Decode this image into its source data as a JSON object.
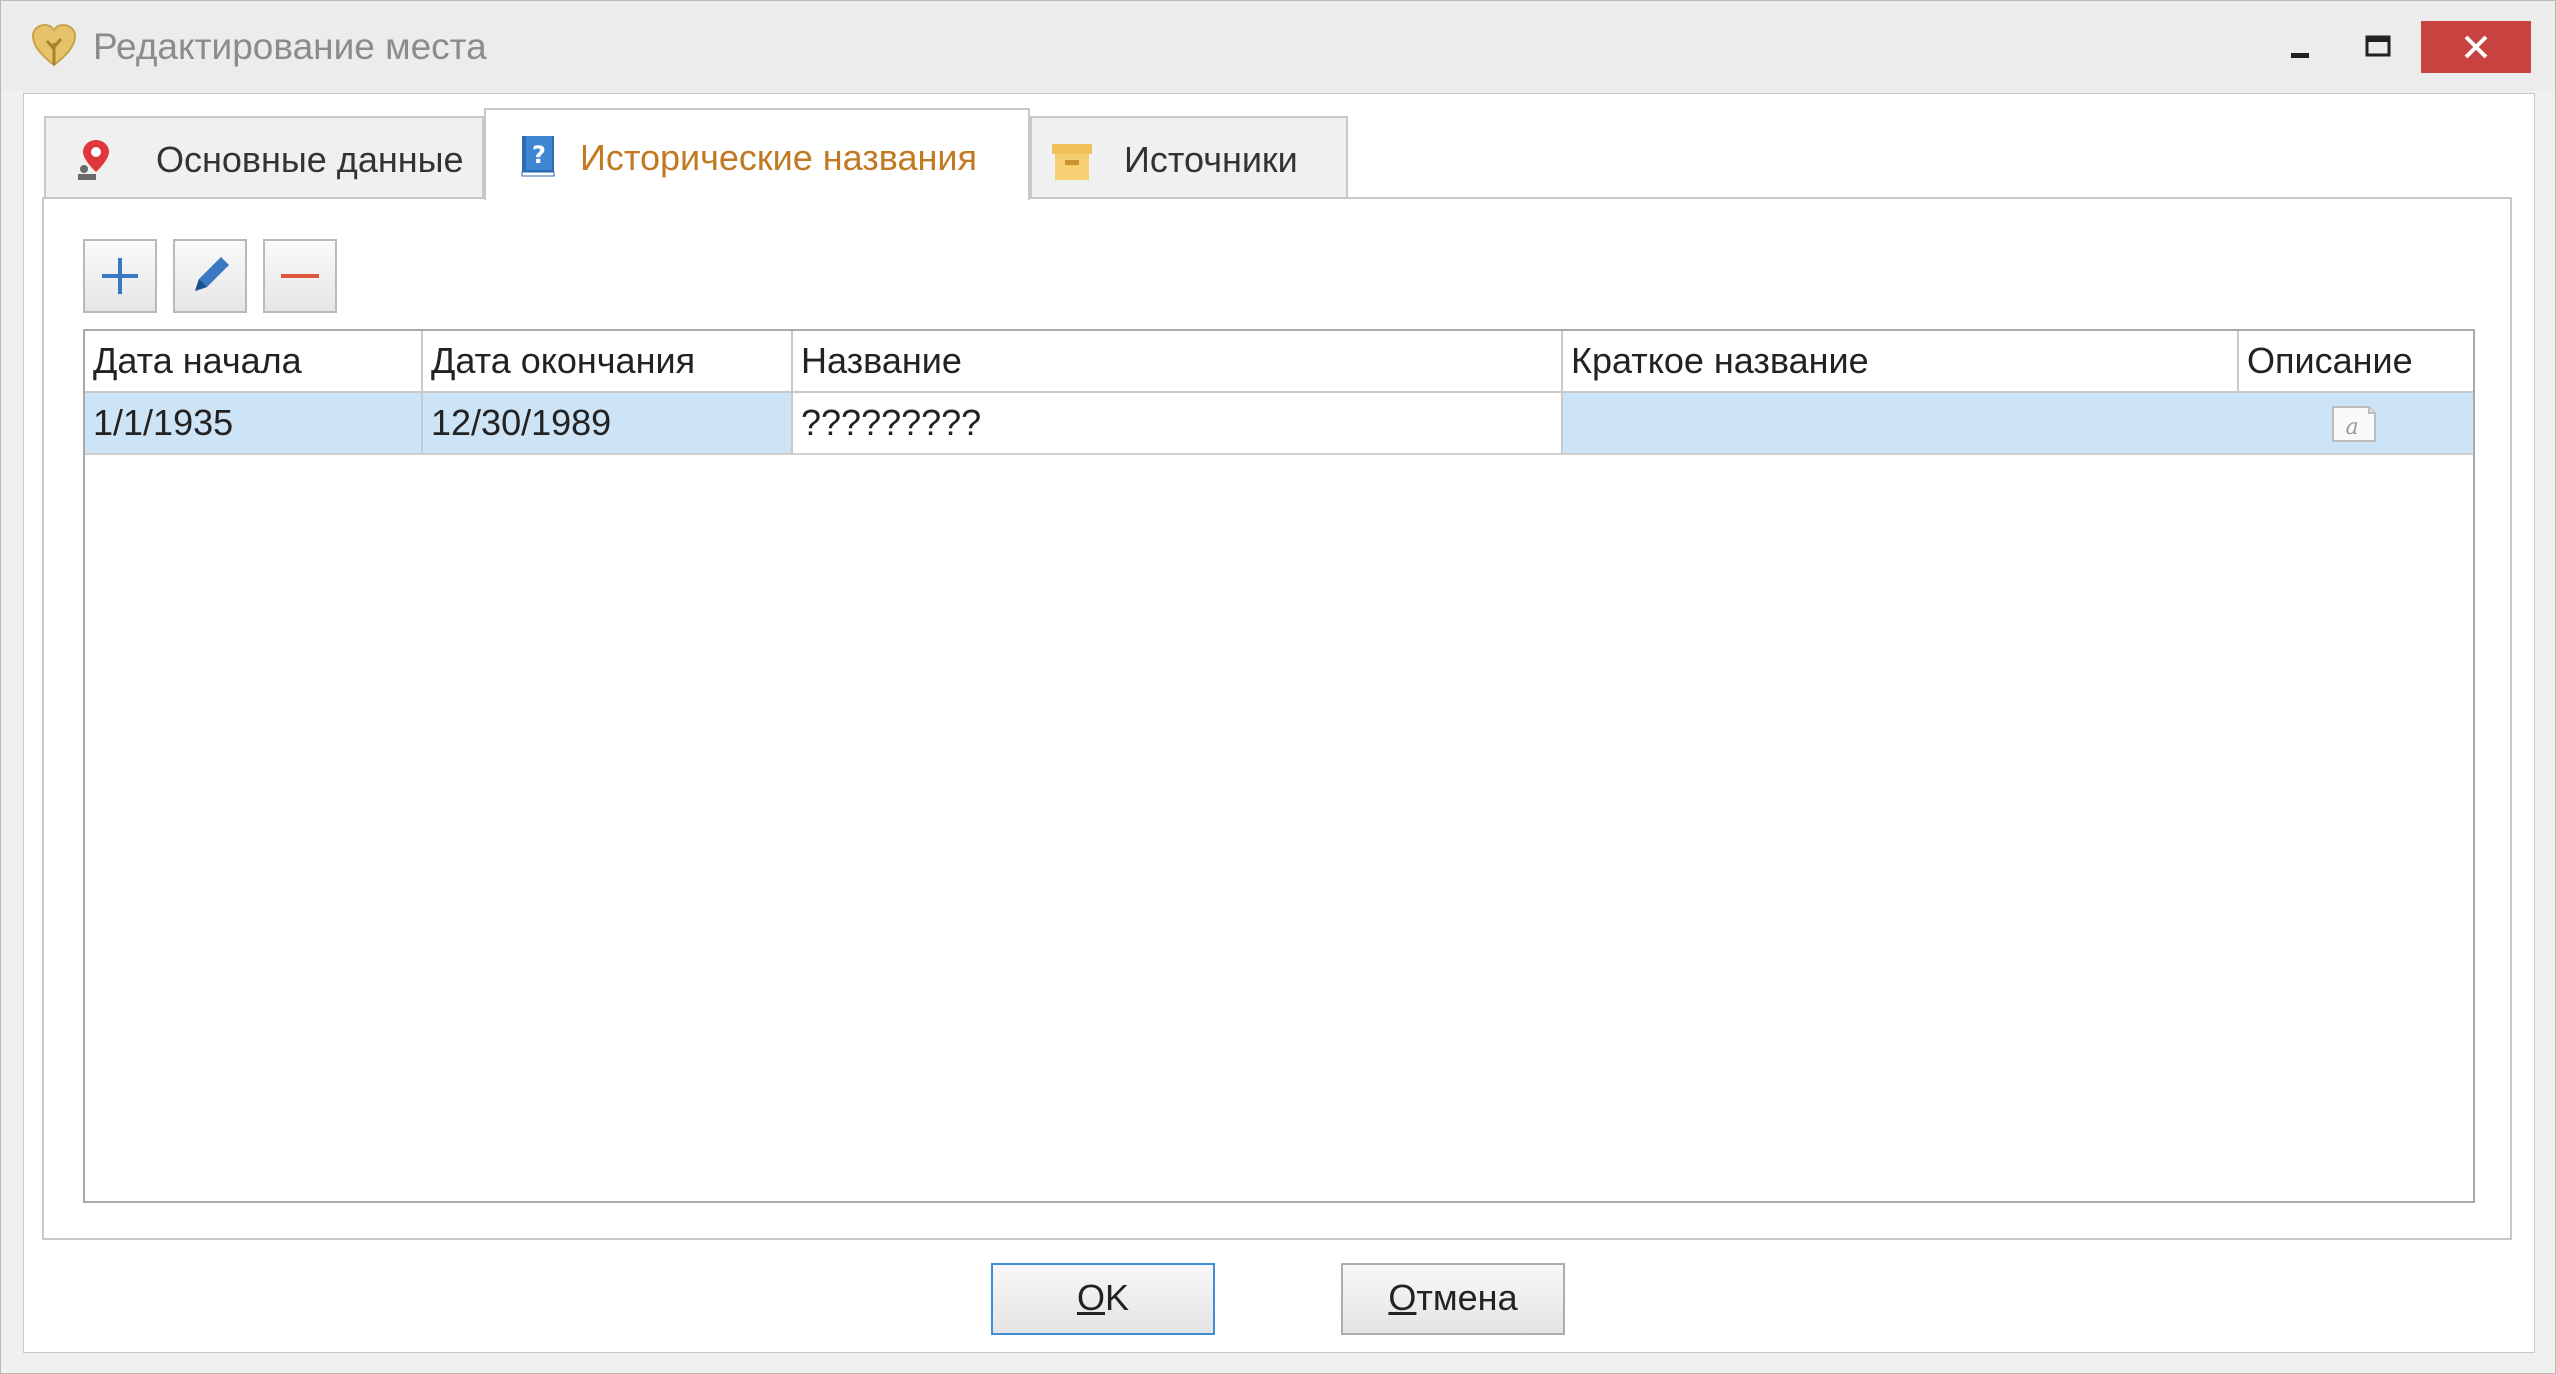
{
  "window": {
    "title": "Редактирование места",
    "controls": {
      "minimize_icon": "minimize-icon",
      "maximize_icon": "maximize-icon",
      "close_icon": "close-icon"
    }
  },
  "tabs": [
    {
      "label": "Основные данные",
      "icon": "map-pin-icon",
      "active": false
    },
    {
      "label": "Исторические названия",
      "icon": "book-question-icon",
      "active": true
    },
    {
      "label": "Источники",
      "icon": "archive-box-icon",
      "active": false
    }
  ],
  "toolbar": {
    "add_icon": "plus-icon",
    "edit_icon": "pencil-icon",
    "delete_icon": "minus-icon"
  },
  "grid": {
    "columns": [
      "Дата начала",
      "Дата окончания",
      "Название",
      "Краткое название",
      "Описание"
    ],
    "rows": [
      {
        "start_date": "1/1/1935",
        "end_date": "12/30/1989",
        "name": "?????????",
        "short_name": "",
        "description_icon": "memo-icon",
        "selected": true
      }
    ]
  },
  "buttons": {
    "ok_mnemonic": "O",
    "ok_rest": "K",
    "cancel_mnemonic": "О",
    "cancel_rest": "тмена"
  },
  "colors": {
    "accent_tab_text": "#c17a22",
    "selection": "#cde4f7",
    "close_button": "#c8423f",
    "ok_border": "#3c8fd6"
  }
}
